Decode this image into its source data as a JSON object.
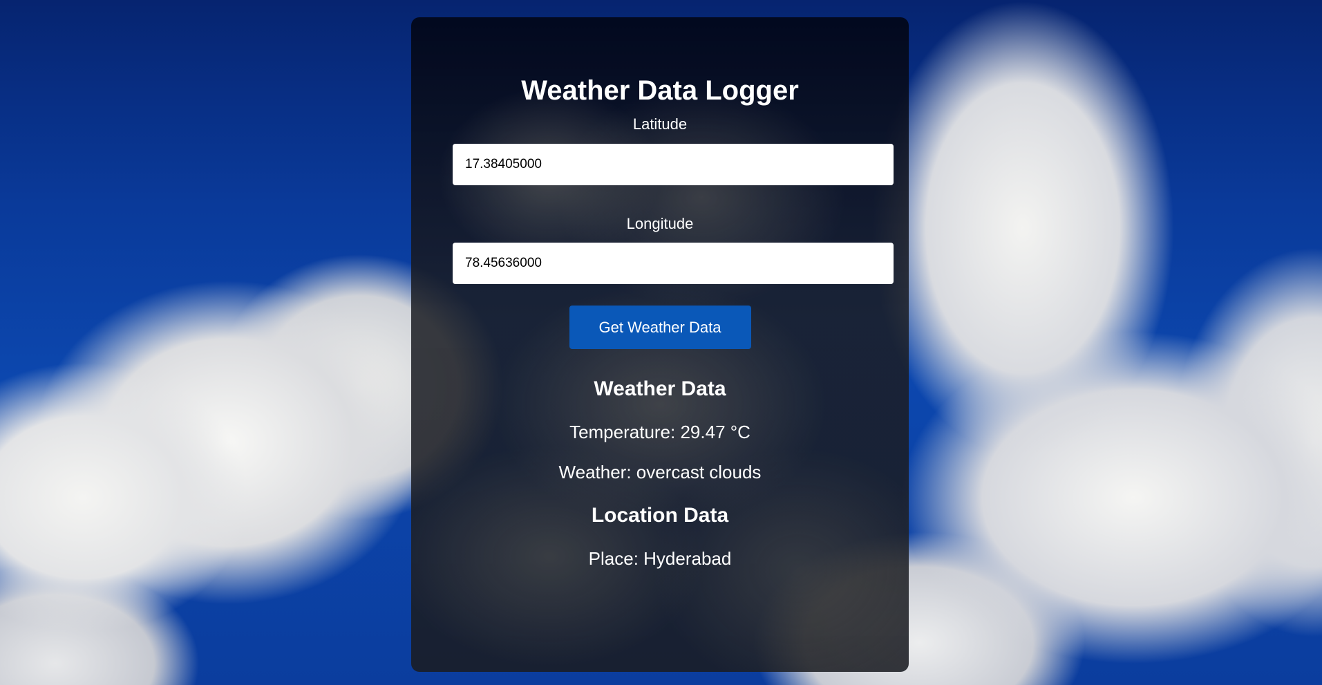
{
  "app": {
    "title": "Weather Data Logger"
  },
  "form": {
    "latitude": {
      "label": "Latitude",
      "value": "17.38405000"
    },
    "longitude": {
      "label": "Longitude",
      "value": "78.45636000"
    },
    "submit_label": "Get Weather Data"
  },
  "weather": {
    "heading": "Weather Data",
    "temperature_text": "Temperature: 29.47 °C",
    "description_text": "Weather: overcast clouds"
  },
  "location": {
    "heading": "Location Data",
    "place_text": "Place: Hyderabad"
  },
  "colors": {
    "button": "#0a58b8",
    "card_background": "#1c1e24",
    "sky": "#0b3d9e",
    "text": "#ffffff"
  }
}
